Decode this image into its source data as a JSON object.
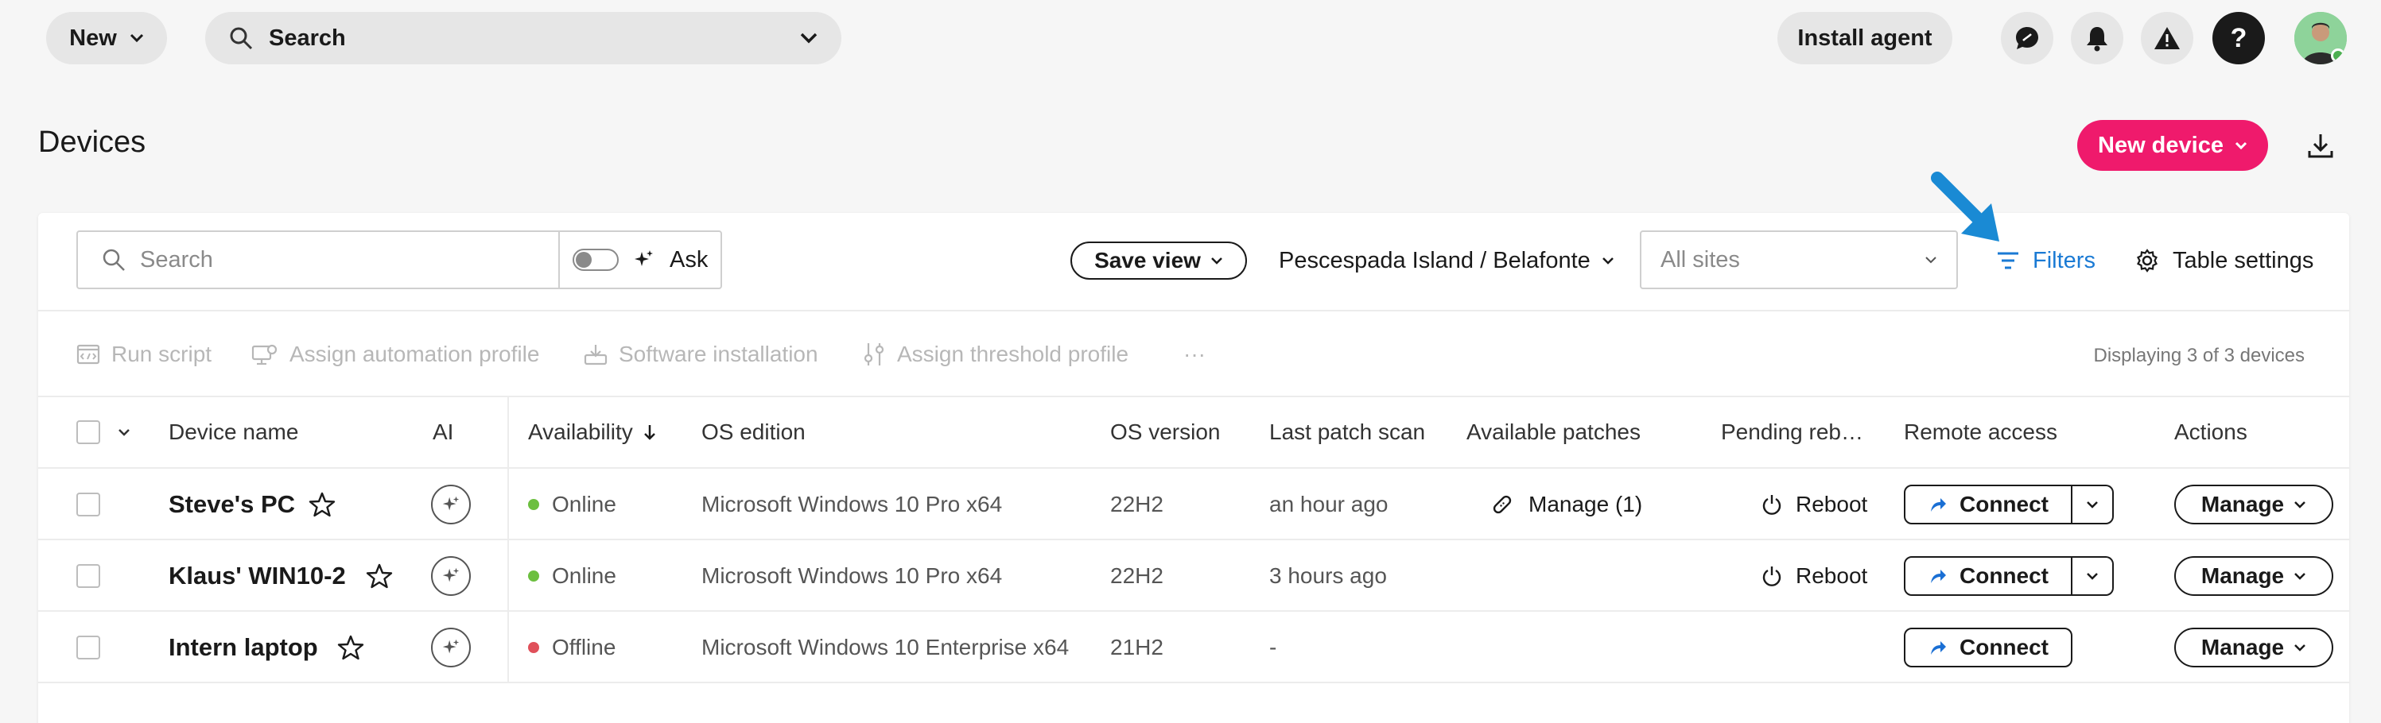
{
  "header": {
    "new_label": "New",
    "search_label": "Search",
    "install_agent_label": "Install agent",
    "help_label": "?"
  },
  "page": {
    "title": "Devices",
    "new_device_label": "New device"
  },
  "toolbar": {
    "search_placeholder": "Search",
    "ask_label": "Ask",
    "save_view_label": "Save view",
    "organization": "Pescespada Island / Belafonte",
    "sites_placeholder": "All sites",
    "filters_label": "Filters",
    "table_settings_label": "Table settings"
  },
  "bulk_actions": {
    "run_script": "Run script",
    "assign_automation_profile": "Assign automation profile",
    "software_installation": "Software installation",
    "assign_threshold_profile": "Assign threshold profile",
    "more": "···",
    "display_count": "Displaying 3 of 3 devices"
  },
  "table": {
    "columns": {
      "device_name": "Device name",
      "ai": "AI",
      "availability": "Availability",
      "os_edition": "OS edition",
      "os_version": "OS version",
      "last_patch_scan": "Last patch scan",
      "available_patches": "Available patches",
      "pending_reboot": "Pending reb…",
      "remote_access": "Remote access",
      "actions": "Actions"
    },
    "rows": [
      {
        "name": "Steve's PC",
        "availability": "Online",
        "os_edition": "Microsoft Windows 10 Pro x64",
        "os_version": "22H2",
        "last_patch_scan": "an hour ago",
        "patches": "Manage (1)",
        "reboot": "Reboot",
        "connect": "Connect",
        "manage": "Manage"
      },
      {
        "name": "Klaus' WIN10-2",
        "availability": "Online",
        "os_edition": "Microsoft Windows 10 Pro x64",
        "os_version": "22H2",
        "last_patch_scan": "3 hours ago",
        "patches": "",
        "reboot": "Reboot",
        "connect": "Connect",
        "manage": "Manage"
      },
      {
        "name": "Intern laptop",
        "availability": "Offline",
        "os_edition": "Microsoft Windows 10 Enterprise x64",
        "os_version": "21H2",
        "last_patch_scan": "-",
        "patches": "",
        "reboot": "",
        "connect": "Connect",
        "manage": "Manage"
      }
    ]
  },
  "colors": {
    "accent": "#ef1a6c",
    "link": "#1a7ad4",
    "online": "#6cbf3f",
    "offline": "#e0505a"
  }
}
